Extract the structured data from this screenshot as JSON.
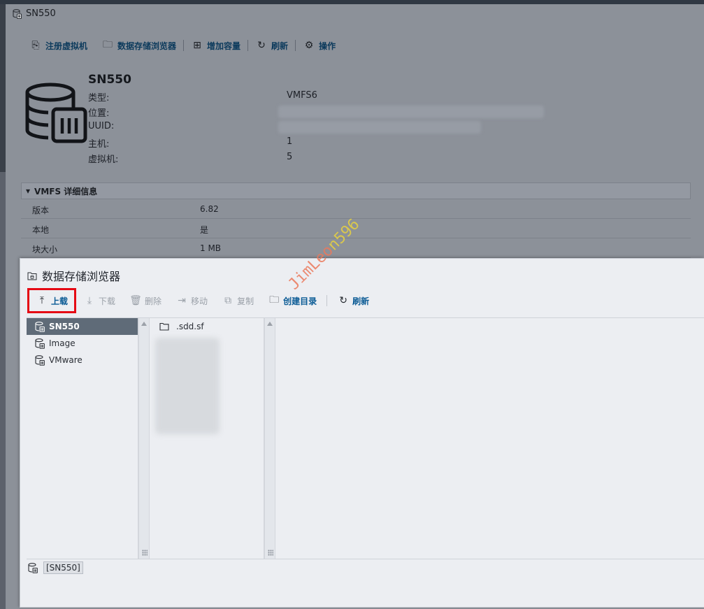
{
  "window": {
    "title": "SN550"
  },
  "actions": [
    {
      "label": "注册虚拟机",
      "icon": "register-vm-icon"
    },
    {
      "label": "数据存储浏览器",
      "icon": "datastore-browser-icon"
    },
    {
      "label": "增加容量",
      "icon": "increase-capacity-icon"
    },
    {
      "label": "刷新",
      "icon": "refresh-icon"
    },
    {
      "label": "操作",
      "icon": "gear-icon"
    }
  ],
  "summary": {
    "name": "SN550",
    "rows": [
      {
        "key": "类型:",
        "value": "VMFS6"
      },
      {
        "key": "位置:",
        "value": ""
      },
      {
        "key": "UUID:",
        "value": ""
      },
      {
        "key": "主机:",
        "value": "1"
      },
      {
        "key": "虚拟机:",
        "value": "5"
      }
    ]
  },
  "vmfs": {
    "header": "VMFS 详细信息",
    "rows": [
      {
        "key": "版本",
        "value": "6.82"
      },
      {
        "key": "本地",
        "value": "是"
      },
      {
        "key": "块大小",
        "value": "1 MB"
      }
    ]
  },
  "dialog": {
    "title": "数据存储浏览器",
    "toolbar": {
      "upload": "上载",
      "download": "下载",
      "delete": "删除",
      "move": "移动",
      "copy": "复制",
      "mkdir": "创建目录",
      "refresh": "刷新"
    },
    "datastores": [
      {
        "label": "SN550",
        "selected": true
      },
      {
        "label": "Image",
        "selected": false
      },
      {
        "label": "VMware",
        "selected": false
      }
    ],
    "files": [
      {
        "label": ".sdd.sf"
      }
    ],
    "status_path": "[SN550]"
  },
  "watermark": {
    "part1": "JimLeo",
    "part2": "n596"
  },
  "colors": {
    "highlight_border": "#e50914",
    "link_blue": "#0b5b95",
    "selected_row": "#5f6b78",
    "overlay": "#8c9199"
  }
}
